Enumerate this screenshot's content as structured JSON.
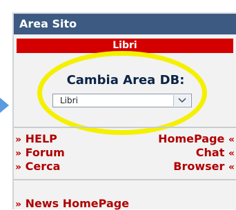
{
  "panel": {
    "title": "Area Sito",
    "section_label": "Libri"
  },
  "area_select": {
    "label": "Cambia Area DB:",
    "selected_value": "Libri"
  },
  "links": {
    "help": "HELP",
    "homepage": "HomePage",
    "forum": "Forum",
    "chat": "Chat",
    "cerca": "Cerca",
    "browser": "Browser",
    "news_homepage": "News HomePage"
  },
  "glyphs": {
    "left_marker": "»",
    "right_marker": "«"
  },
  "colors": {
    "header_bg": "#3c5a82",
    "section_bar": "#d40000",
    "link_text": "#b00000",
    "highlight_ring": "#f4f000",
    "pointer_arrow": "#5a9be0"
  },
  "icons": {
    "dropdown": "chevron-down-icon",
    "pointer": "arrow-right-icon"
  }
}
